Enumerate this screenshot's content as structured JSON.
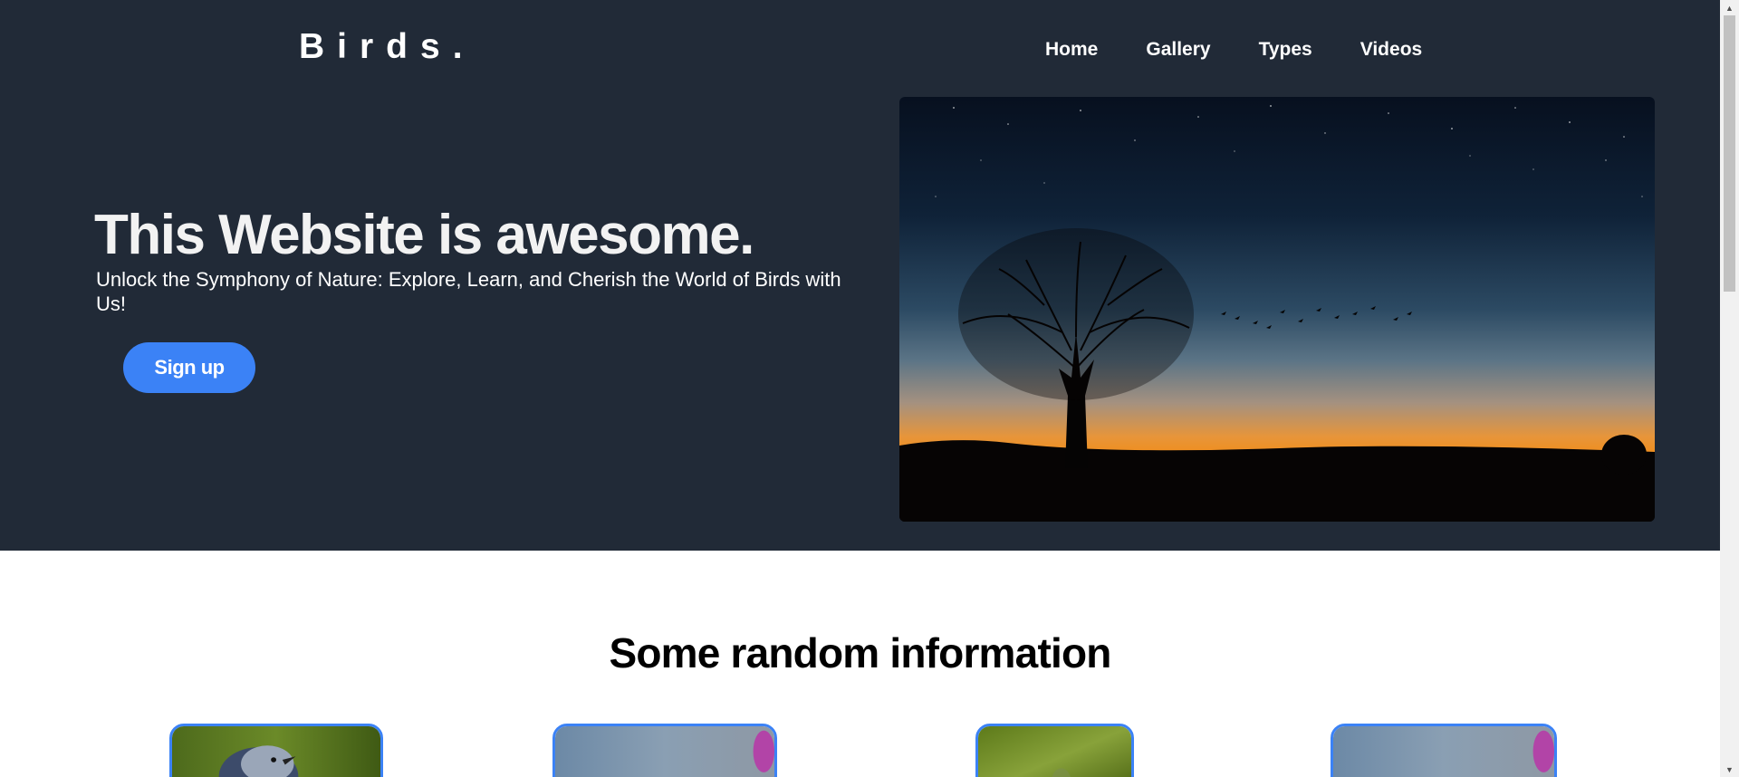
{
  "brand": {
    "logo": "Birds."
  },
  "nav": {
    "items": [
      {
        "label": "Home"
      },
      {
        "label": "Gallery"
      },
      {
        "label": "Types"
      },
      {
        "label": "Videos"
      }
    ]
  },
  "hero": {
    "headline": "This Website is awesome.",
    "subline": "Unlock the Symphony of Nature: Explore, Learn, and Cherish the World of Birds with Us!",
    "signup_label": "Sign up",
    "photo_icon": "sunset-tree-birds-image"
  },
  "info": {
    "title": "Some random information",
    "cards": [
      {
        "icon": "blue-jay-image"
      },
      {
        "icon": "bird-flower-image"
      },
      {
        "icon": "green-bird-image"
      },
      {
        "icon": "bird-flower-image"
      }
    ]
  },
  "colors": {
    "hero_bg": "#212a37",
    "accent": "#3b82f6",
    "text_light": "#ffffff"
  }
}
